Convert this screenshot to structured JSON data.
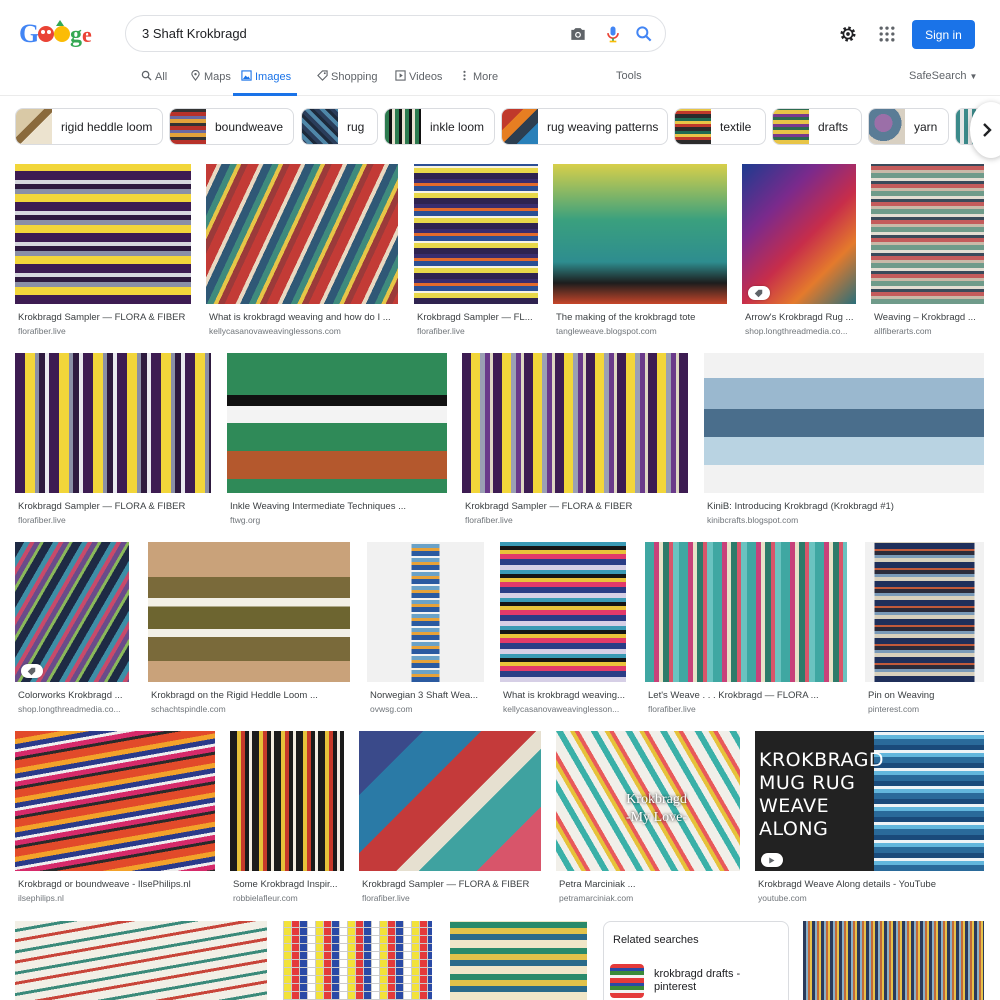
{
  "brand": {
    "name": "Google"
  },
  "search": {
    "query": "3 Shaft Krokbragd"
  },
  "header": {
    "signin_label": "Sign in"
  },
  "tabs": {
    "all": "All",
    "maps": "Maps",
    "images": "Images",
    "shopping": "Shopping",
    "videos": "Videos",
    "more": "More",
    "tools": "Tools",
    "safesearch": "SafeSearch"
  },
  "chips": [
    {
      "label": "rigid heddle loom"
    },
    {
      "label": "boundweave"
    },
    {
      "label": "rug"
    },
    {
      "label": "inkle loom"
    },
    {
      "label": "rug weaving patterns"
    },
    {
      "label": "textile"
    },
    {
      "label": "drafts"
    },
    {
      "label": "yarn"
    }
  ],
  "results": [
    {
      "title": "Krokbragd Sampler — FLORA & FIBER",
      "site": "florafiber.live"
    },
    {
      "title": "What is krokbragd weaving and how do I ...",
      "site": "kellycasanovaweavinglessons.com"
    },
    {
      "title": "Krokbragd Sampler — FL...",
      "site": "florafiber.live"
    },
    {
      "title": "The making of the krokbragd tote",
      "site": "tangleweave.blogspot.com"
    },
    {
      "title": "Arrow's Krokbragd Rug ...",
      "site": "shop.longthreadmedia.co..."
    },
    {
      "title": "Weaving – Krokbragd ...",
      "site": "allfiberarts.com"
    },
    {
      "title": "Krokbragd Sampler — FLORA & FIBER",
      "site": "florafiber.live"
    },
    {
      "title": "Inkle Weaving Intermediate Techniques ...",
      "site": "ftwg.org"
    },
    {
      "title": "Krokbragd Sampler — FLORA & FIBER",
      "site": "florafiber.live"
    },
    {
      "title": "KiniB: Introducing Krokbragd (Krokbragd #1)",
      "site": "kinibcrafts.blogspot.com"
    },
    {
      "title": "Colorworks Krokbragd ...",
      "site": "shop.longthreadmedia.co..."
    },
    {
      "title": "Krokbragd on the Rigid Heddle Loom ...",
      "site": "schachtspindle.com"
    },
    {
      "title": "Norwegian 3 Shaft Wea...",
      "site": "ovwsg.com"
    },
    {
      "title": "What is krokbragd weaving...",
      "site": "kellycasanovaweavinglesson..."
    },
    {
      "title": "Let's Weave . . . Krokbragd — FLORA ...",
      "site": "florafiber.live"
    },
    {
      "title": "Pin on Weaving",
      "site": "pinterest.com"
    },
    {
      "title": "Krokbragd or boundweave - IlsePhilips.nl",
      "site": "ilsephilips.nl"
    },
    {
      "title": "Some Krokbragd Inspir...",
      "site": "robbielafleur.com"
    },
    {
      "title": "Krokbragd Sampler — FLORA & FIBER",
      "site": "florafiber.live"
    },
    {
      "title": "Petra Marciniak ...",
      "site": "petramarciniak.com"
    },
    {
      "title": "Krokbragd Weave Along details - YouTube",
      "site": "youtube.com"
    }
  ],
  "overlays": {
    "petra_line1": "Krokbragd",
    "petra_line2": "-My Love-",
    "mug_line1": "KROKBRAGD",
    "mug_line2": "MUG RUG",
    "mug_line3": "WEAVE",
    "mug_line4": "ALONG"
  },
  "related": {
    "heading": "Related searches",
    "item_label": "krokbragd drafts - pinterest"
  },
  "colors": {
    "accent": "#1a73e8",
    "chip_border": "#dadce0",
    "site_text": "#70757a"
  }
}
